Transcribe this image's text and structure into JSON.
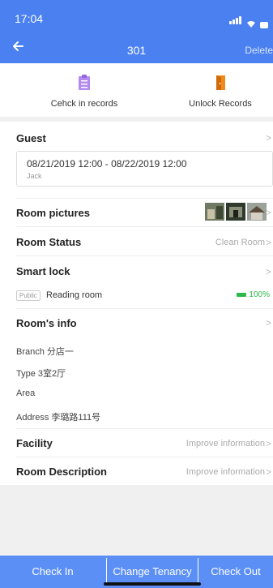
{
  "status": {
    "time": "17:04"
  },
  "nav": {
    "back_icon": "arrow-left-icon",
    "title": "301",
    "delete_label": "Delete"
  },
  "actions": {
    "check_in_records": {
      "label": "Cehck in records",
      "icon": "clipboard-list-icon",
      "color": "#b48af0"
    },
    "unlock_records": {
      "label": "Unlock Records",
      "icon": "door-icon",
      "color": "#f08a1c"
    }
  },
  "guest": {
    "title": "Guest",
    "dates": "08/21/2019 12:00 - 08/22/2019 12:00",
    "name": "Jack"
  },
  "room_pictures": {
    "title": "Room pictures"
  },
  "room_status": {
    "title": "Room Status",
    "value": "Clean Room"
  },
  "smart_lock": {
    "title": "Smart lock",
    "tag": "Public",
    "lock_name": "Reading room",
    "battery": "100%"
  },
  "room_info": {
    "title": "Room's info",
    "branch": "Branch 分店一",
    "type": "Type 3室2厅",
    "area": "Area",
    "address": "Address 李璐路111号"
  },
  "facility": {
    "title": "Facility",
    "value": "Improve information"
  },
  "room_description": {
    "title": "Room Description",
    "value": "Improve information"
  },
  "bottom": {
    "check_in": "Check In",
    "change_tenancy": "Change Tenancy",
    "check_out": "Check Out"
  },
  "colors": {
    "header": "#4a80f0",
    "bottom_bar": "#5b8ff5",
    "battery_green": "#2cb84a"
  }
}
